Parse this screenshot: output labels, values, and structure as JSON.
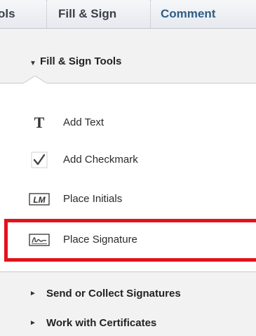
{
  "tabs": [
    {
      "label": "ols"
    },
    {
      "label": "Fill & Sign"
    },
    {
      "label": "Comment"
    }
  ],
  "section": {
    "title": "Fill & Sign Tools",
    "expanded_marker": "▼"
  },
  "items": [
    {
      "label": "Add Text",
      "icon": "text-T-icon"
    },
    {
      "label": "Add Checkmark",
      "icon": "checkmark-icon"
    },
    {
      "label": "Place Initials",
      "icon": "initials-icon",
      "icon_text": "LM"
    },
    {
      "label": "Place Signature",
      "icon": "signature-icon"
    }
  ],
  "collapsed_sections": [
    {
      "label": "Send or Collect Signatures",
      "marker": "►"
    },
    {
      "label": "Work with Certificates",
      "marker": "►"
    }
  ],
  "colors": {
    "highlight": "#e3121b",
    "comment_tab": "#2f5d86"
  }
}
